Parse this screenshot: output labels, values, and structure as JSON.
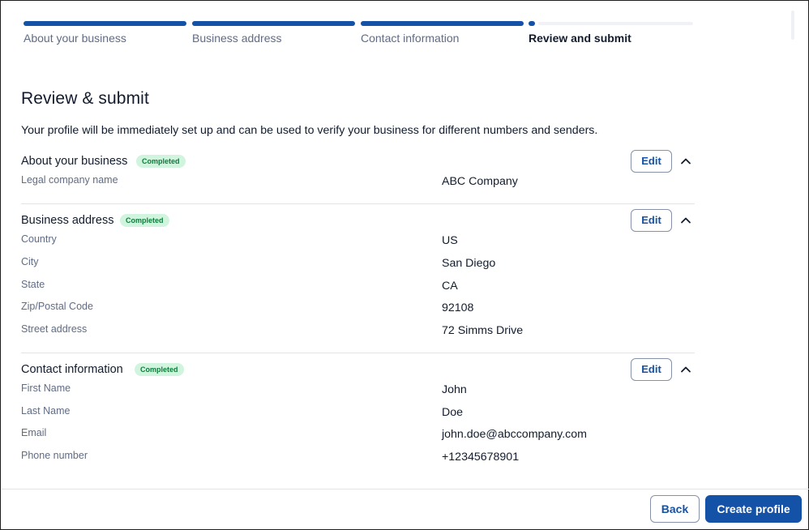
{
  "steps": [
    {
      "label": "About your business",
      "state": "complete"
    },
    {
      "label": "Business address",
      "state": "complete"
    },
    {
      "label": "Contact information",
      "state": "complete"
    },
    {
      "label": "Review and submit",
      "state": "current"
    }
  ],
  "page": {
    "title": "Review & submit",
    "subtitle": "Your profile will be immediately set up and can be used to verify your business for different numbers and senders."
  },
  "sections": [
    {
      "title": "About your business",
      "badge": "Completed",
      "edit_label": "Edit",
      "fields": [
        {
          "label": "Legal company name",
          "value": "ABC Company"
        }
      ]
    },
    {
      "title": "Business address",
      "badge": "Completed",
      "edit_label": "Edit",
      "fields": [
        {
          "label": "Country",
          "value": "US"
        },
        {
          "label": "City",
          "value": "San Diego"
        },
        {
          "label": "State",
          "value": "CA"
        },
        {
          "label": "Zip/Postal Code",
          "value": "92108"
        },
        {
          "label": "Street address",
          "value": "72 Simms Drive"
        }
      ]
    },
    {
      "title": "Contact information",
      "badge": "Completed",
      "edit_label": "Edit",
      "fields": [
        {
          "label": "First Name",
          "value": "John"
        },
        {
          "label": "Last Name",
          "value": "Doe"
        },
        {
          "label": "Email",
          "value": "john.doe@abccompany.com"
        },
        {
          "label": "Phone number",
          "value": "+12345678901"
        }
      ]
    }
  ],
  "footer": {
    "back_label": "Back",
    "create_label": "Create profile"
  },
  "icons": {
    "collapse": "chevron-up-icon"
  },
  "colors": {
    "primary": "#1452a7",
    "badge_bg": "#d1f4df",
    "badge_text": "#0e7c3a",
    "muted_text": "#606b85"
  }
}
